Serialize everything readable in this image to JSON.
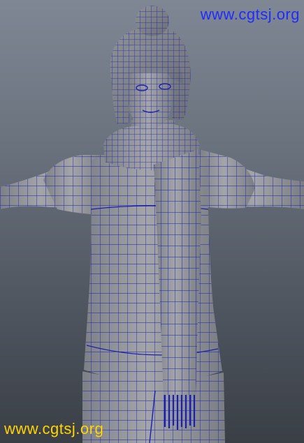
{
  "watermark": {
    "top_text": "www.cgtsj.org",
    "bottom_text": "www.cgtsj.org",
    "top_color": "#1e2cff",
    "bottom_color": "#ffd400"
  },
  "scene": {
    "subject": "3d-character-wireframe-mesh",
    "background_top": "#7e8793",
    "background_bottom": "#3a3f46",
    "mesh_color": "#9a9ca0",
    "wire_color": "#1b1fb0"
  }
}
